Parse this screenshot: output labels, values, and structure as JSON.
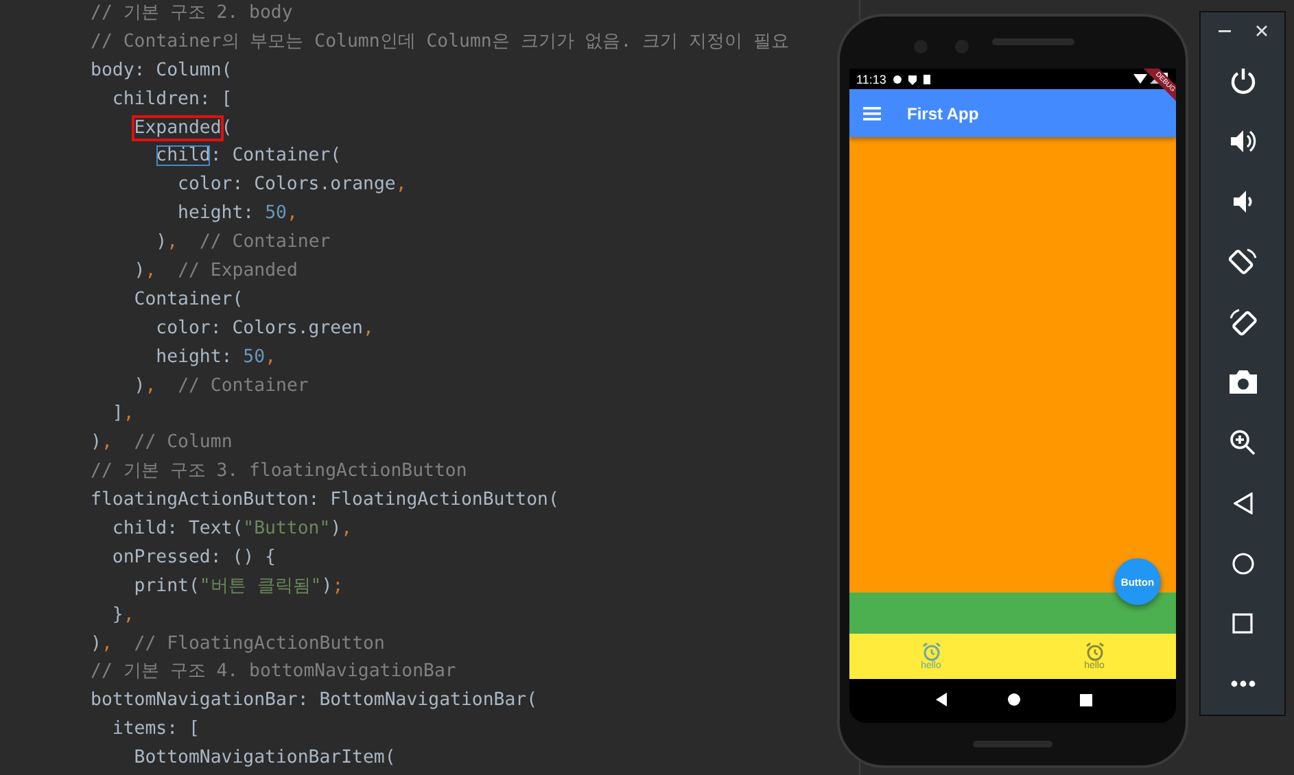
{
  "editor": {
    "lines": [
      [
        {
          "kind": "comment",
          "text": "// 기본 구조 2. body"
        }
      ],
      [
        {
          "kind": "comment",
          "text": "// Container의 부모는 Column인데 Column은 크기가 없음. 크기 지정이 필요"
        }
      ],
      [
        {
          "kind": "plain",
          "text": "body: Column("
        }
      ],
      [
        {
          "kind": "plain",
          "text": "  children: ["
        }
      ],
      [
        {
          "kind": "error",
          "text": "    Expanded"
        },
        {
          "kind": "plain",
          "text": "("
        }
      ],
      [
        {
          "kind": "match",
          "text": "      child"
        },
        {
          "kind": "plain",
          "text": ": Container("
        }
      ],
      [
        {
          "kind": "plain",
          "text": "        color: Colors.orange"
        },
        {
          "kind": "punct",
          "text": ","
        }
      ],
      [
        {
          "kind": "plain",
          "text": "        height: "
        },
        {
          "kind": "number",
          "text": "50"
        },
        {
          "kind": "punct",
          "text": ","
        }
      ],
      [
        {
          "kind": "plain",
          "text": "      )"
        },
        {
          "kind": "punct",
          "text": ","
        },
        {
          "kind": "comment",
          "text": "  // Container"
        }
      ],
      [
        {
          "kind": "plain",
          "text": "    )"
        },
        {
          "kind": "punct",
          "text": ","
        },
        {
          "kind": "comment",
          "text": "  // Expanded"
        }
      ],
      [
        {
          "kind": "plain",
          "text": "    Container("
        }
      ],
      [
        {
          "kind": "plain",
          "text": "      color: Colors.green"
        },
        {
          "kind": "punct",
          "text": ","
        }
      ],
      [
        {
          "kind": "plain",
          "text": "      height: "
        },
        {
          "kind": "number",
          "text": "50"
        },
        {
          "kind": "punct",
          "text": ","
        }
      ],
      [
        {
          "kind": "plain",
          "text": "    )"
        },
        {
          "kind": "punct",
          "text": ","
        },
        {
          "kind": "comment",
          "text": "  // Container"
        }
      ],
      [
        {
          "kind": "plain",
          "text": "  ]"
        },
        {
          "kind": "punct",
          "text": ","
        }
      ],
      [
        {
          "kind": "plain",
          "text": ")"
        },
        {
          "kind": "punct",
          "text": ","
        },
        {
          "kind": "comment",
          "text": "  // Column"
        }
      ],
      [
        {
          "kind": "comment",
          "text": "// 기본 구조 3. floatingActionButton"
        }
      ],
      [
        {
          "kind": "plain",
          "text": "floatingActionButton: FloatingActionButton("
        }
      ],
      [
        {
          "kind": "plain",
          "text": "  child: Text("
        },
        {
          "kind": "string",
          "text": "\"Button\""
        },
        {
          "kind": "plain",
          "text": ")"
        },
        {
          "kind": "punct",
          "text": ","
        }
      ],
      [
        {
          "kind": "plain",
          "text": "  onPressed: () {"
        }
      ],
      [
        {
          "kind": "plain",
          "text": "    print("
        },
        {
          "kind": "string",
          "text": "\"버튼 클릭됨\""
        },
        {
          "kind": "plain",
          "text": ")"
        },
        {
          "kind": "punct",
          "text": ";"
        }
      ],
      [
        {
          "kind": "plain",
          "text": "  }"
        },
        {
          "kind": "punct",
          "text": ","
        }
      ],
      [
        {
          "kind": "plain",
          "text": ")"
        },
        {
          "kind": "punct",
          "text": ","
        },
        {
          "kind": "comment",
          "text": "  // FloatingActionButton"
        }
      ],
      [
        {
          "kind": "comment",
          "text": "// 기본 구조 4. bottomNavigationBar"
        }
      ],
      [
        {
          "kind": "plain",
          "text": "bottomNavigationBar: BottomNavigationBar("
        }
      ],
      [
        {
          "kind": "plain",
          "text": "  items: ["
        }
      ],
      [
        {
          "kind": "plain",
          "text": "    BottomNavigationBarItem("
        }
      ]
    ]
  },
  "phone": {
    "status_bar": {
      "time": "11:13"
    },
    "app_bar": {
      "title": "First App"
    },
    "debug_banner": "DEBUG",
    "fab": {
      "label": "Button"
    },
    "bottom_nav": {
      "items": [
        {
          "label": "hello",
          "selected": true
        },
        {
          "label": "hello",
          "selected": false
        }
      ]
    }
  }
}
